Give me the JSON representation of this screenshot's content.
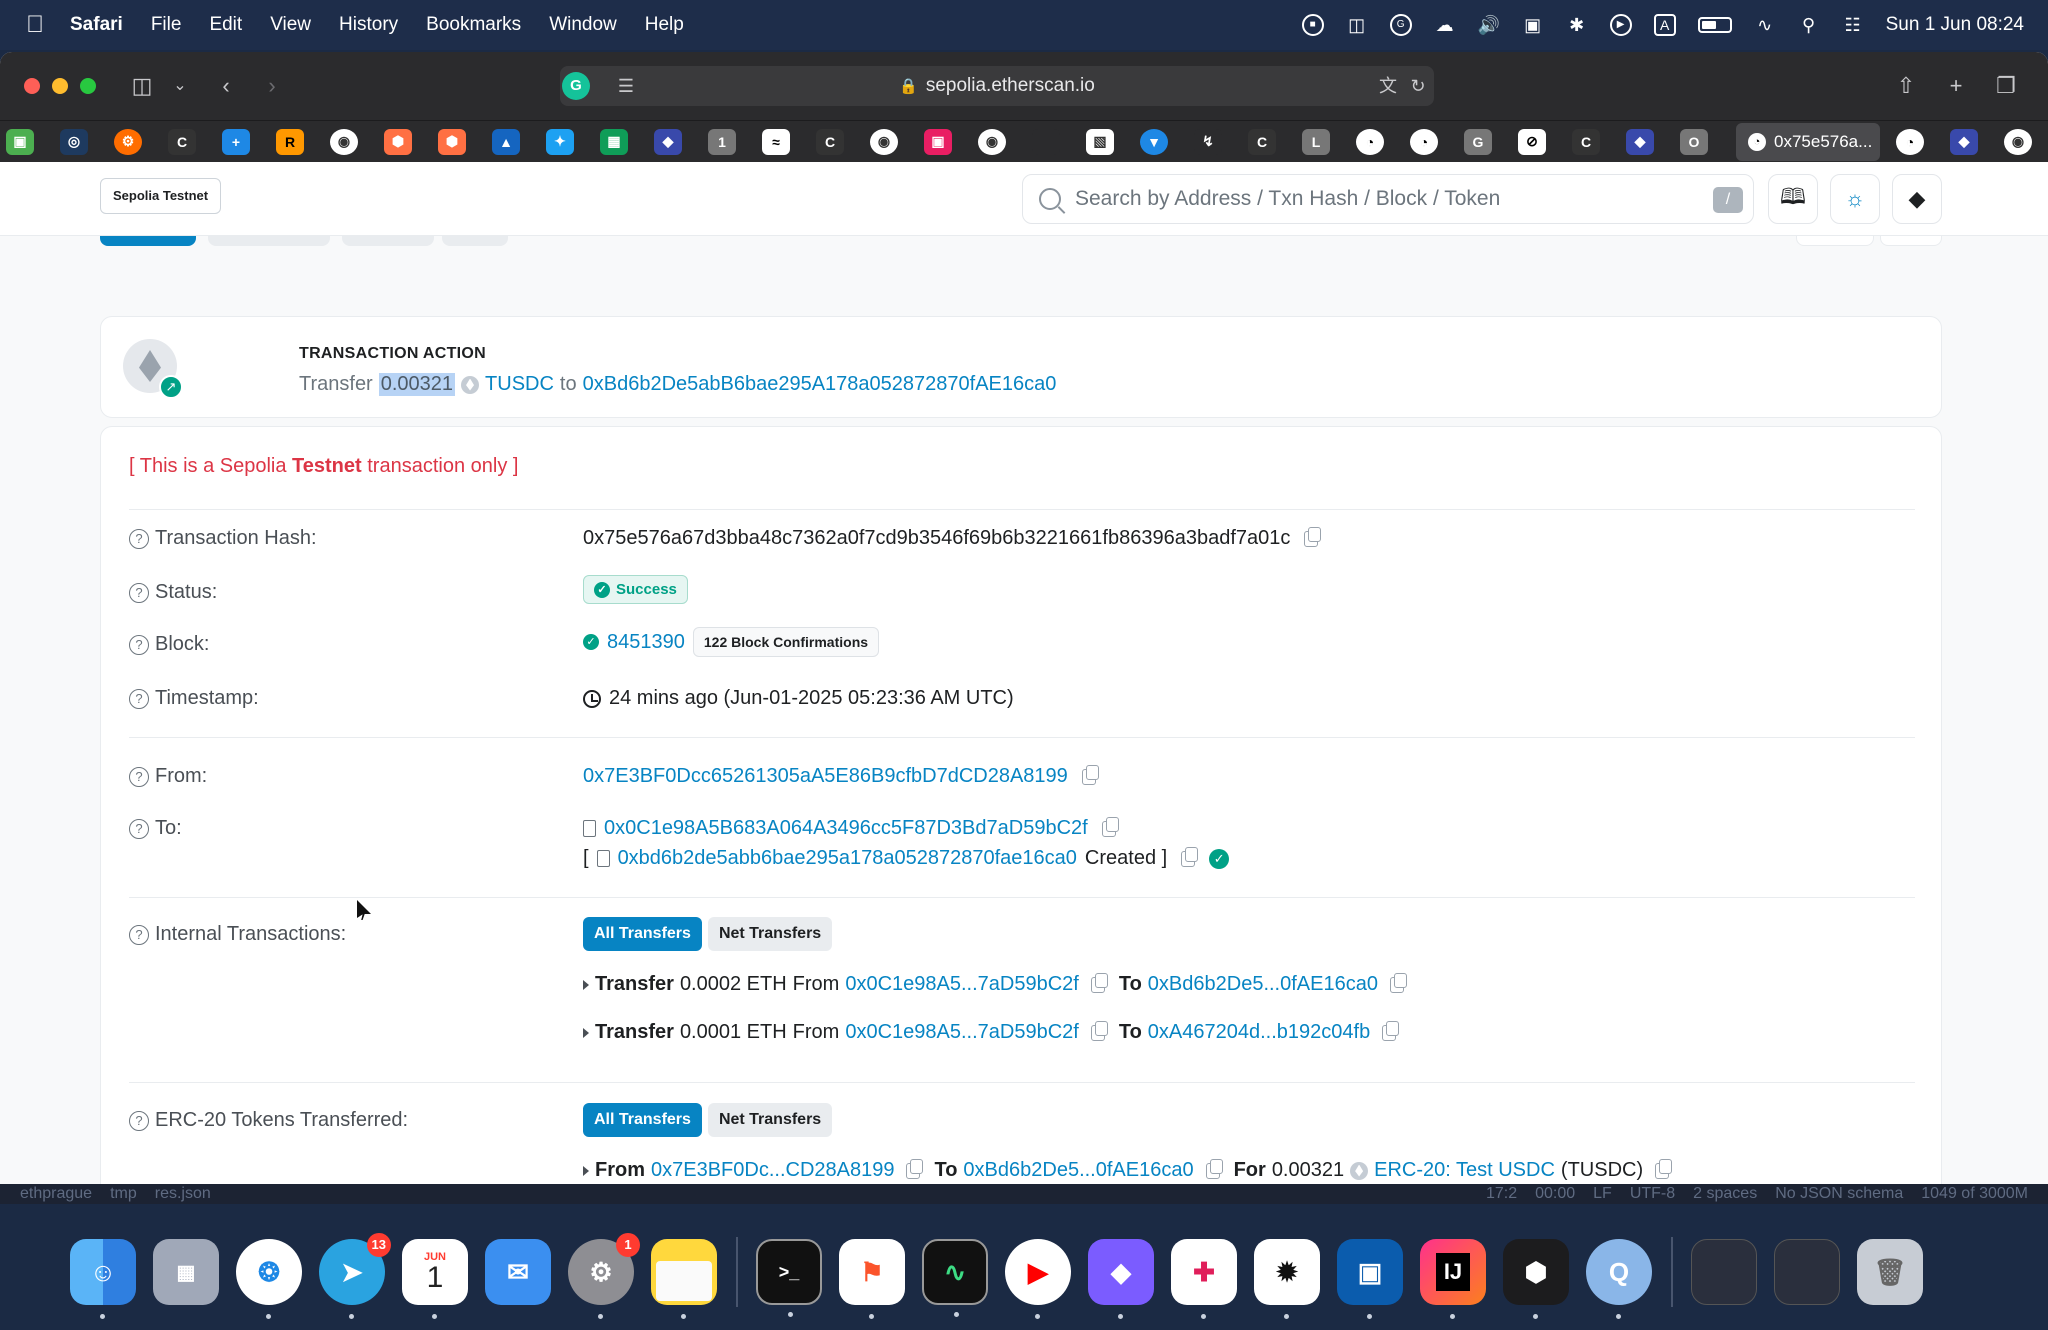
{
  "menubar": {
    "app": "Safari",
    "items": [
      "File",
      "Edit",
      "View",
      "History",
      "Bookmarks",
      "Window",
      "Help"
    ],
    "clock": "Sun 1 Jun  08:24"
  },
  "browser": {
    "url": "sepolia.etherscan.io",
    "active_tab_label": "0x75e576a..."
  },
  "header": {
    "network_badge": "Sepolia Testnet",
    "search_placeholder": "Search by Address / Txn Hash / Block / Token",
    "search_shortcut": "/"
  },
  "action": {
    "title": "TRANSACTION ACTION",
    "verb": "Transfer",
    "amount": "0.00321",
    "token": "TUSDC",
    "to_word": "to",
    "to_address": "0xBd6b2De5abB6bae295A178a052872870fAE16ca0"
  },
  "details": {
    "testnet_note_pre": "[ This is a Sepolia ",
    "testnet_note_bold": "Testnet",
    "testnet_note_post": " transaction only ]",
    "tx_hash_label": "Transaction Hash:",
    "tx_hash": "0x75e576a67d3bba48c7362a0f7cd9b3546f69b6b3221661fb86396a3badf7a01c",
    "status_label": "Status:",
    "status": "Success",
    "block_label": "Block:",
    "block": "8451390",
    "confirmations": "122 Block Confirmations",
    "timestamp_label": "Timestamp:",
    "timestamp": "24 mins ago (Jun-01-2025 05:23:36 AM UTC)",
    "from_label": "From:",
    "from": "0x7E3BF0Dcc65261305aA5E86B9cfbD7dCD28A8199",
    "to_label": "To:",
    "to": "0x0C1e98A5B683A064A3496cc5F87D3Bd7aD59bC2f",
    "created_open": "[",
    "created_address": "0xbd6b2de5abb6bae295a178a052872870fae16ca0",
    "created_word": "Created ]",
    "internal_label": "Internal Transactions:",
    "erc20_label": "ERC-20 Tokens Transferred:",
    "all_transfers": "All Transfers",
    "net_transfers": "Net Transfers",
    "internal_txs": [
      {
        "verb": "Transfer",
        "amount": "0.0002 ETH",
        "from_word": "From",
        "from": "0x0C1e98A5...7aD59bC2f",
        "to_word": "To",
        "to": "0xBd6b2De5...0fAE16ca0"
      },
      {
        "verb": "Transfer",
        "amount": "0.0001 ETH",
        "from_word": "From",
        "from": "0x0C1e98A5...7aD59bC2f",
        "to_word": "To",
        "to": "0xA467204d...b192c04fb"
      }
    ],
    "erc20": {
      "from_word": "From",
      "from": "0x7E3BF0Dc...CD28A8199",
      "to_word": "To",
      "to": "0xBd6b2De5...0fAE16ca0",
      "for_word": "For",
      "amount": "0.00321",
      "token_link": "ERC-20: Test USDC",
      "token_symbol": "(TUSDC)"
    }
  },
  "ide_strip": {
    "left": [
      "ethprague",
      "tmp",
      "res.json"
    ],
    "right": [
      "17:2",
      "00:00",
      "LF",
      "UTF-8",
      "2 spaces",
      "No JSON schema",
      "1049 of 3000M"
    ]
  },
  "dock": {
    "telegram_badge": "13",
    "settings_badge": "1",
    "calendar_month": "JUN",
    "calendar_day": "1"
  },
  "colors": {
    "link": "#0784c3",
    "success": "#00a186",
    "testnet_red": "#dc3545"
  }
}
